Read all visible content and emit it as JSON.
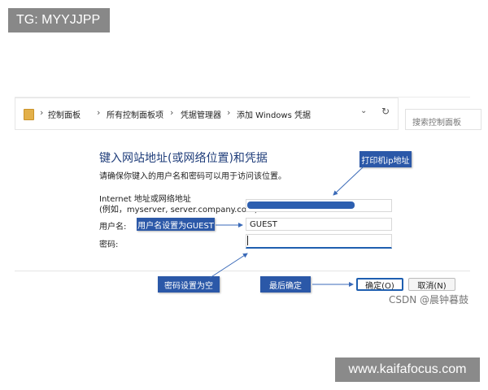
{
  "overlays": {
    "top_tag": "TG: MYYJJPP",
    "bottom_tag": "www.kaifafocus.com",
    "watermark": "CSDN @晨钟暮鼓"
  },
  "address_bar": {
    "folder_icon": "control-panel-icon",
    "crumbs": [
      "控制面板",
      "所有控制面板项",
      "凭据管理器",
      "添加 Windows 凭据"
    ],
    "search_placeholder": "搜索控制面板"
  },
  "form": {
    "heading": "键入网站地址(或网络位置)和凭据",
    "subheading": "请确保你键入的用户名和密码可以用于访问该位置。",
    "address_label_line1": "Internet 地址或网络地址",
    "address_label_line2": "(例如，myserver, server.company.com):",
    "username_label": "用户名:",
    "username_value": "GUEST",
    "password_label": "密码:",
    "password_value": ""
  },
  "callouts": {
    "printer_address": "打印机ip地址",
    "username_hint": "用户名设置为GUEST",
    "password_hint": "密码设置为空",
    "confirm_hint": "最后确定"
  },
  "buttons": {
    "ok": "确定(O)",
    "cancel": "取消(N)"
  },
  "colors": {
    "callout_bg": "#2b58a8",
    "heading": "#1f3d7a",
    "accent": "#1f5fb0"
  }
}
